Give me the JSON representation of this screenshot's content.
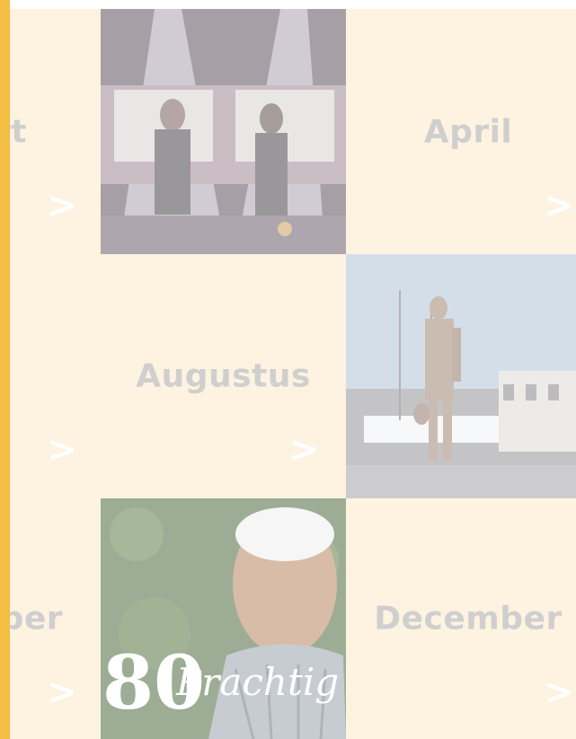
{
  "colors": {
    "accent": "#f4bd43",
    "tile_bg": "#fdf3e0",
    "label": "#cfcfcf"
  },
  "tiles": {
    "r1c1": {
      "label": "rt",
      "arrow": ">"
    },
    "r1c3": {
      "label": "April",
      "arrow": ">"
    },
    "r2c1": {
      "arrow": ">"
    },
    "r2c2": {
      "label": "Augustus",
      "arrow": ">"
    },
    "r3c1": {
      "label": "ber",
      "arrow": ">"
    },
    "r3c3": {
      "label": "December",
      "arrow": ">"
    }
  },
  "photos": {
    "concert": {
      "icon": "photo-stage-performers"
    },
    "statue": {
      "icon": "photo-statue-harbor"
    },
    "portrait": {
      "icon": "photo-elderly-man",
      "overlay_text": "80",
      "overlay_script": "Prachtig"
    }
  }
}
